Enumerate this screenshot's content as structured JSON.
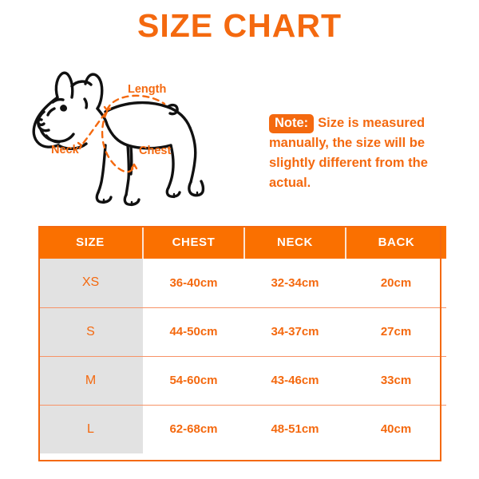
{
  "page": {
    "title": "SIZE CHART",
    "background_color": "#ffffff",
    "accent_color": "#F4690F",
    "header_color": "#FA7000",
    "size_column_color": "#e2e2e2"
  },
  "illustration": {
    "subject": "french-bulldog-line-drawing",
    "measurement_labels": {
      "length": "Length",
      "chest": "Chest",
      "neck": "Neck"
    },
    "line_color": "#111111",
    "guide_color": "#F4690F"
  },
  "note": {
    "badge": "Note:",
    "text": "Size is measured manually, the size will be slightly different from the actual."
  },
  "table": {
    "columns": [
      "SIZE",
      "CHEST",
      "NECK",
      "BACK"
    ],
    "rows": [
      {
        "size": "XS",
        "chest": "36-40cm",
        "neck": "32-34cm",
        "back": "20cm"
      },
      {
        "size": "S",
        "chest": "44-50cm",
        "neck": "34-37cm",
        "back": "27cm"
      },
      {
        "size": "M",
        "chest": "54-60cm",
        "neck": "43-46cm",
        "back": "33cm"
      },
      {
        "size": "L",
        "chest": "62-68cm",
        "neck": "48-51cm",
        "back": "40cm"
      }
    ]
  }
}
